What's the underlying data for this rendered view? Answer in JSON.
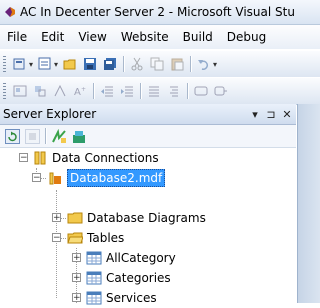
{
  "window": {
    "title": "AC In Decenter Server 2 - Microsoft Visual Stu",
    "logo_icon": "visual-studio-logo-icon"
  },
  "menu": [
    "File",
    "Edit",
    "View",
    "Website",
    "Build",
    "Debug"
  ],
  "toolbar1_icons": [
    "add-project-icon",
    "add-item-icon",
    "open-file-icon",
    "save-icon",
    "save-all-icon",
    "cut-icon",
    "copy-icon",
    "paste-icon",
    "undo-icon"
  ],
  "toolbar2_icons": [
    "object-icon",
    "icon-2",
    "icon-3",
    "font-icon",
    "outdent-icon",
    "indent-icon",
    "comment-icon",
    "uncomment-icon",
    "icon-9",
    "icon-10"
  ],
  "server_explorer": {
    "title": "Server Explorer",
    "controls": {
      "dropdown": "▾",
      "pin": "⊐",
      "close": "✕"
    },
    "toolbar_icons": [
      "refresh-icon",
      "stop-icon",
      "connect-to-database-icon",
      "connect-to-server-icon"
    ],
    "tree": {
      "root": "Data Connections",
      "database": "Database2.mdf",
      "children": [
        "Database Diagrams",
        "Tables"
      ],
      "tables": [
        "AllCategory",
        "Categories",
        "Services"
      ]
    }
  },
  "colors": {
    "selection": "#3399ff",
    "folder": "#f2c94c",
    "table_icon": "#4a7ebb"
  }
}
